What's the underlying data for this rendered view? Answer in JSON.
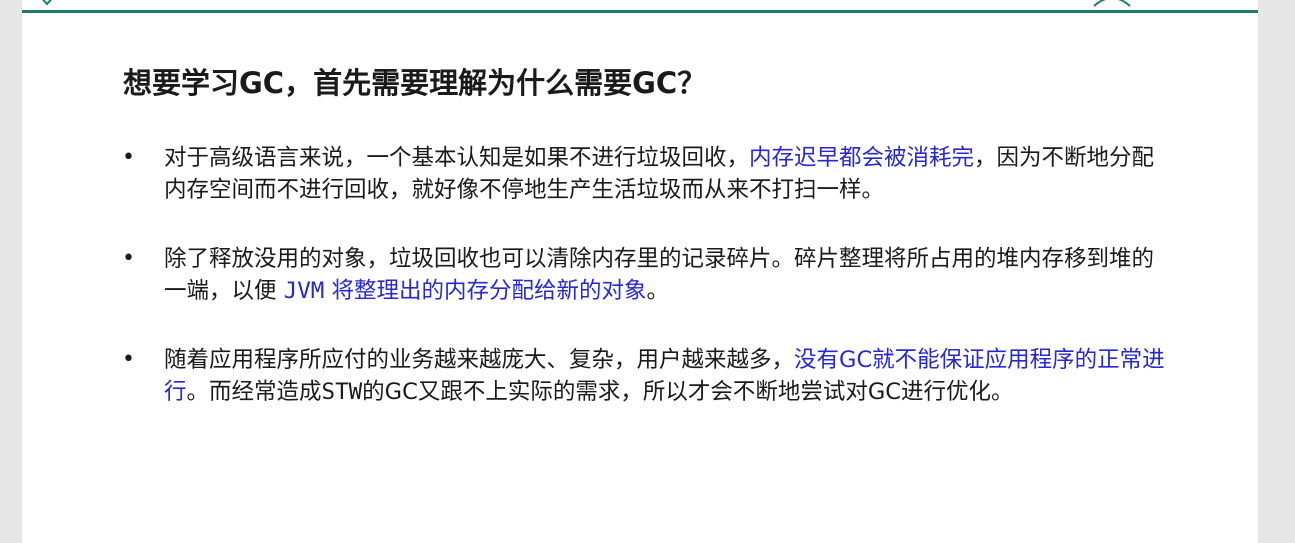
{
  "slide": {
    "title": "想要学习GC，首先需要理解为什么需要GC？",
    "bullet_marker": "•",
    "bullets": [
      {
        "parts": [
          {
            "text": "对于高级语言来说，一个基本认知是如果不进行垃圾回收，",
            "highlight": false
          },
          {
            "text": "内存迟早都会被消耗完",
            "highlight": true
          },
          {
            "text": "，因为不断地分配内存空间而不进行回收，就好像不停地生产生活垃圾而从来不打扫一样。",
            "highlight": false
          }
        ]
      },
      {
        "parts": [
          {
            "text": "除了释放没用的对象，垃圾回收也可以清除内存里的记录碎片。碎片整理将所占用的堆内存移到堆的一端，以便 ",
            "highlight": false
          },
          {
            "text": "JVM",
            "highlight": true,
            "mono": true
          },
          {
            "text": " 将整理出的内存分配给新的对象",
            "highlight": true
          },
          {
            "text": "。",
            "highlight": false
          }
        ]
      },
      {
        "parts": [
          {
            "text": "随着应用程序所应付的业务越来越庞大、复杂，用户越来越多，",
            "highlight": false
          },
          {
            "text": "没有GC就不能保证应用程序的正常进行",
            "highlight": true
          },
          {
            "text": "。而经常造成",
            "highlight": false
          },
          {
            "text": "STW",
            "highlight": false,
            "mono": true
          },
          {
            "text": "的GC又跟不上实际的需求，所以才会不断地尝试对GC进行优化。",
            "highlight": false
          }
        ]
      }
    ]
  },
  "colors": {
    "accent_rule": "#1f7a6e",
    "highlight_text": "#2828d0",
    "body_text": "#1a1a1a",
    "frame_bg": "#e6e6e6"
  }
}
